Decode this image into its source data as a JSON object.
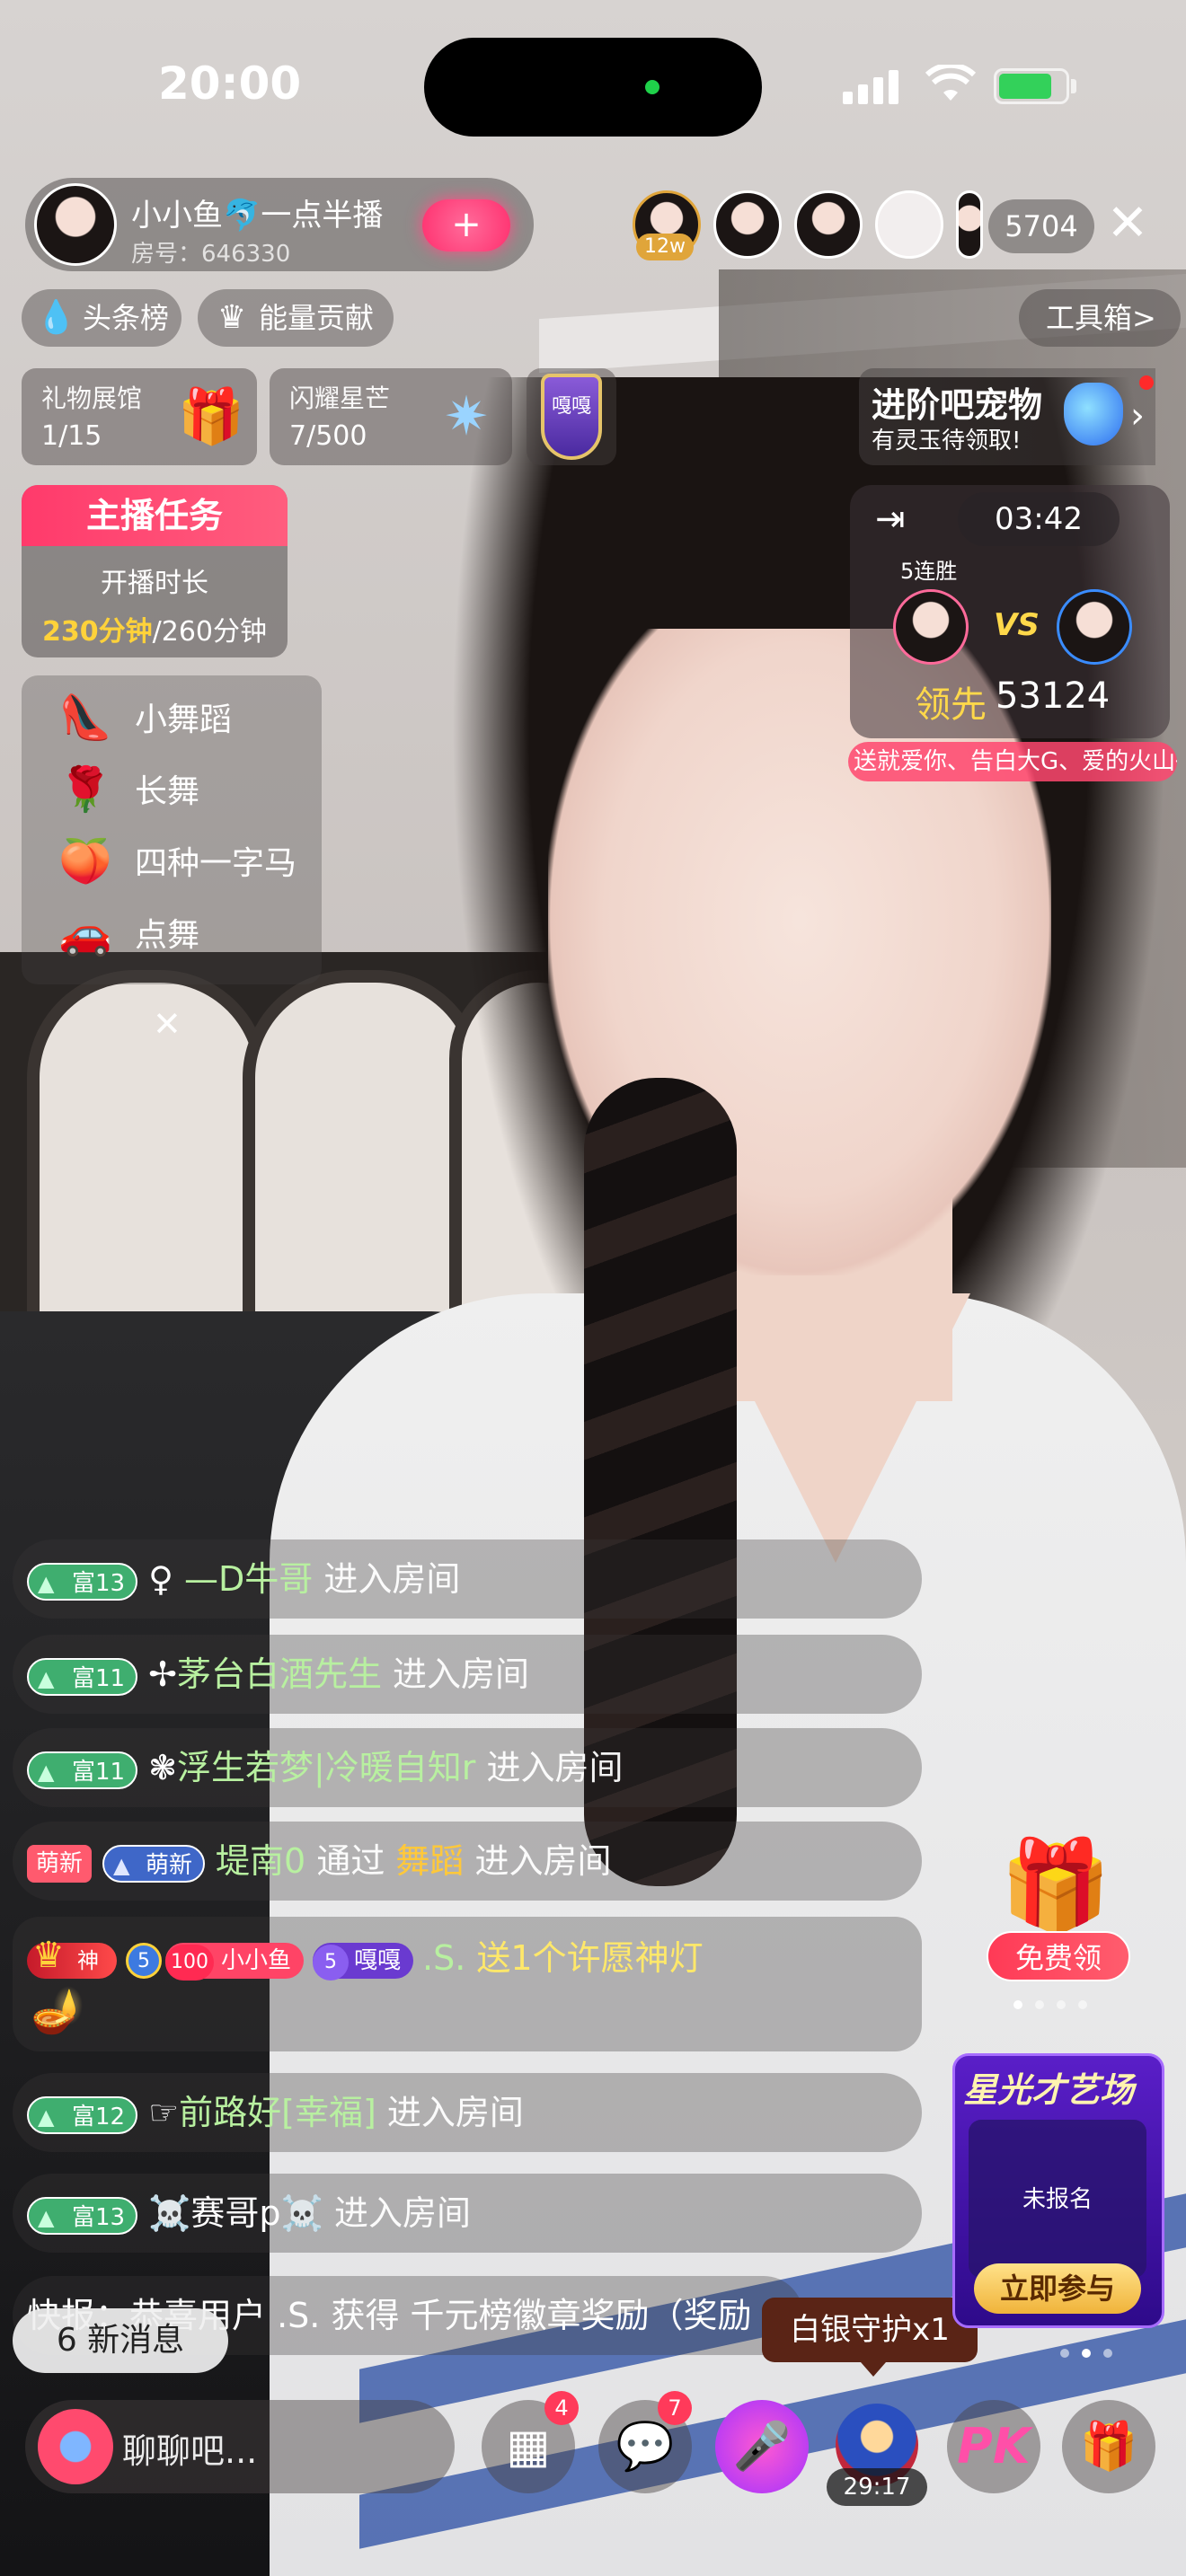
{
  "status_bar": {
    "time": "20:00"
  },
  "host": {
    "name": "小小鱼🐬一点半播",
    "room": "房号：646330",
    "follow_icon": "plus-icon"
  },
  "viewers": {
    "tag": "12w",
    "count": "5704"
  },
  "chips": [
    {
      "icon": "flame-icon",
      "label": "头条榜"
    },
    {
      "icon": "crown-icon",
      "label": "能量贡献"
    }
  ],
  "toolbox": {
    "label": "工具箱",
    "arrow": ">"
  },
  "gift_cards": [
    {
      "label": "礼物展馆",
      "value": "1/15",
      "icon": "gift-box-icon"
    },
    {
      "label": "闪耀星芒",
      "value": "7/500",
      "icon": "star-crystal-icon"
    }
  ],
  "badge": {
    "text": "嘎嘎"
  },
  "pet_banner": {
    "title": "进阶吧宠物",
    "subtitle": "有灵玉待领取!",
    "arrow": "›"
  },
  "task": {
    "title": "主播任务",
    "line1": "开播时长",
    "progress": "230分钟",
    "total": "/260分钟"
  },
  "menu": [
    {
      "icon": "crystal-shoe-icon",
      "label": "小舞蹈",
      "glyph": "👠"
    },
    {
      "icon": "rose-icon",
      "label": "长舞",
      "glyph": "🌹"
    },
    {
      "icon": "peach-icon",
      "label": "四种一字马",
      "glyph": "🍑"
    },
    {
      "icon": "car-icon",
      "label": "点舞",
      "glyph": "🚗"
    }
  ],
  "pk": {
    "timer": "03:42",
    "streak": "5连胜",
    "vs": "VS",
    "lead_label": "领先",
    "score": "53124",
    "marquee": "送就爱你、告白大G、爱的火山得"
  },
  "chat": {
    "rows": [
      {
        "level": "富13",
        "icon": "♀",
        "name": "—D牛哥",
        "action": "进入房间"
      },
      {
        "level": "富11",
        "icon": "✢",
        "name": "茅台白酒先生",
        "action": "进入房间"
      },
      {
        "level": "富11",
        "icon": "❃",
        "name": "浮生若梦|冷暖自知r",
        "action": "进入房间"
      },
      {
        "tag1": "萌新",
        "tag2": "萌新",
        "name": "堤南0",
        "mid": "通过",
        "via": "舞蹈",
        "action": "进入房间"
      },
      {
        "tag": "神",
        "coin": "5",
        "fan_lvl": "100",
        "fan_name": "小小鱼",
        "fan2_lvl": "5",
        "fan2_name": "嘎嘎",
        "name": ".S.",
        "action": "送1个许愿神灯"
      },
      {
        "level": "富12",
        "icon": "☞",
        "name": "前路好[幸福]",
        "action": "进入房间"
      },
      {
        "level": "富13",
        "name": "☠️赛哥p☠️",
        "action": "进入房间"
      }
    ],
    "news": "快报：恭喜用户 .S. 获得 千元榜徽章奖励（奖励"
  },
  "new_messages": "6 新消息",
  "guard_tip": "白银守护x1",
  "free_gift": {
    "label": "免费领"
  },
  "star_card": {
    "title": "星光才艺场",
    "status": "未报名",
    "button": "立即参与"
  },
  "bottom": {
    "placeholder": "聊聊吧...",
    "apps_badge": "4",
    "msg_badge": "7",
    "pk_label": "PK",
    "guard_timer": "29:17"
  }
}
